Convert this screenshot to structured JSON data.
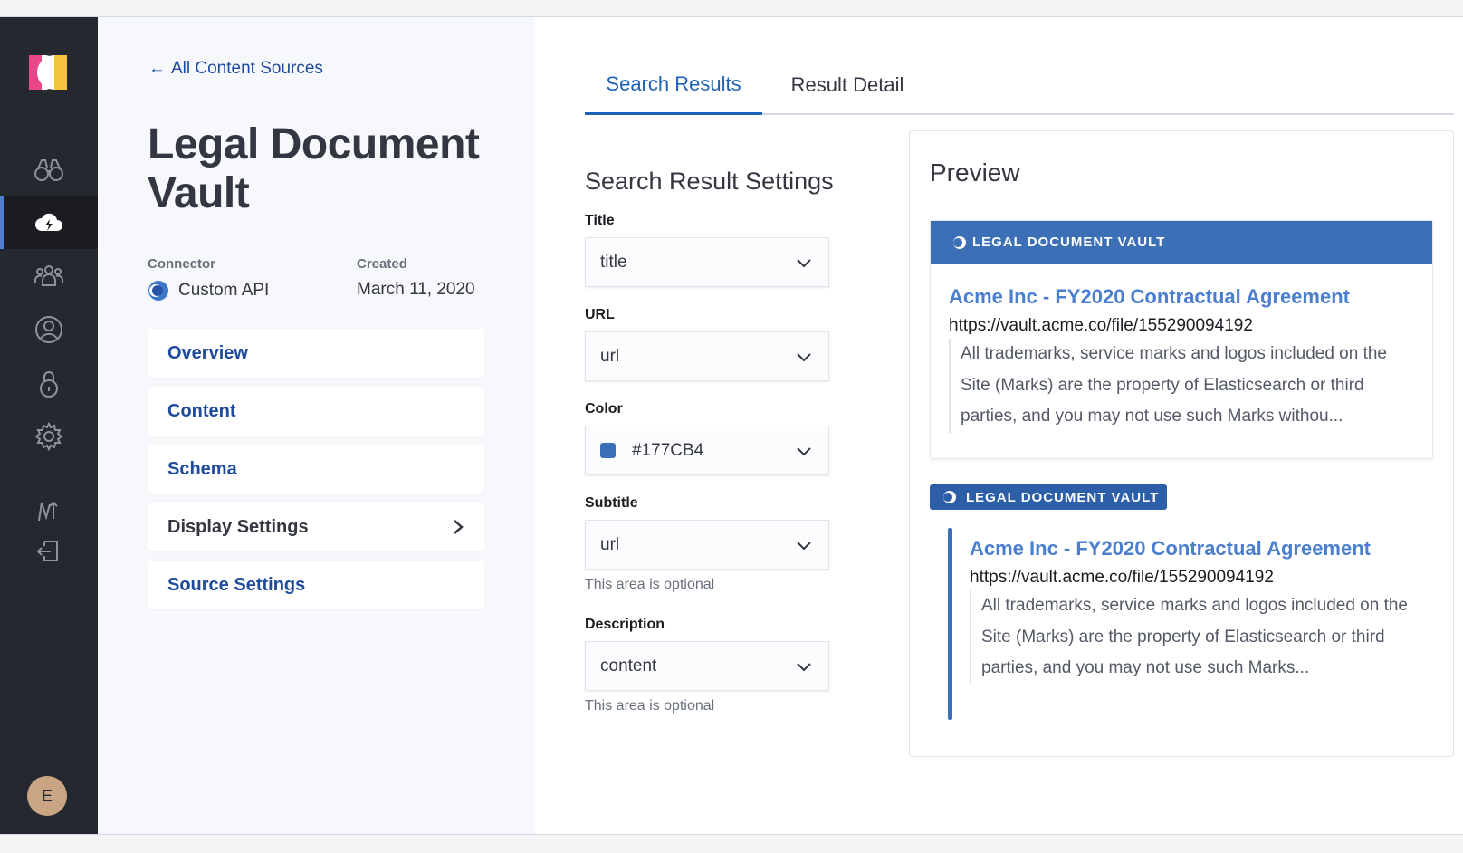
{
  "nav": {
    "icons": [
      "binoculars-icon",
      "cloud-bolt-icon",
      "users-icon",
      "user-circle-icon",
      "lock-icon",
      "gear-icon",
      "workflow-icon",
      "logout-icon"
    ],
    "active": "cloud-bolt-icon",
    "user_initial": "E"
  },
  "left": {
    "back_label": "All Content Sources",
    "title": "Legal Document Vault",
    "connector_label": "Connector",
    "connector_value": "Custom API",
    "created_label": "Created",
    "created_value": "March 11, 2020",
    "menu": [
      {
        "label": "Overview"
      },
      {
        "label": "Content"
      },
      {
        "label": "Schema"
      },
      {
        "label": "Display Settings"
      },
      {
        "label": "Source Settings"
      }
    ]
  },
  "tabs": [
    {
      "label": "Search Results",
      "active": true
    },
    {
      "label": "Result Detail",
      "active": false
    }
  ],
  "settings": {
    "heading": "Search Result Settings",
    "fields": [
      {
        "label": "Title",
        "value": "title"
      },
      {
        "label": "URL",
        "value": "url"
      },
      {
        "label": "Color",
        "value": "#177CB4"
      },
      {
        "label": "Subtitle",
        "value": "url",
        "help": "This area is optional"
      },
      {
        "label": "Description",
        "value": "content",
        "help": "This area is optional"
      }
    ]
  },
  "preview": {
    "heading": "Preview",
    "source_label": "LEGAL DOCUMENT VAULT",
    "accent": "#3b6fb6",
    "result1": {
      "title": "Acme Inc - FY2020 Contractual Agreement",
      "url": "https://vault.acme.co/file/155290094192",
      "desc": "All trademarks, service marks and logos included on the Site (Marks) are the property of Elasticsearch or third parties, and you may not use such Marks withou..."
    },
    "result2": {
      "title": "Acme Inc - FY2020 Contractual Agreement",
      "url": "https://vault.acme.co/file/155290094192",
      "desc": "All trademarks, service marks and logos included on the Site (Marks) are the property of Elasticsearch or third parties, and you may not use such Marks..."
    }
  }
}
